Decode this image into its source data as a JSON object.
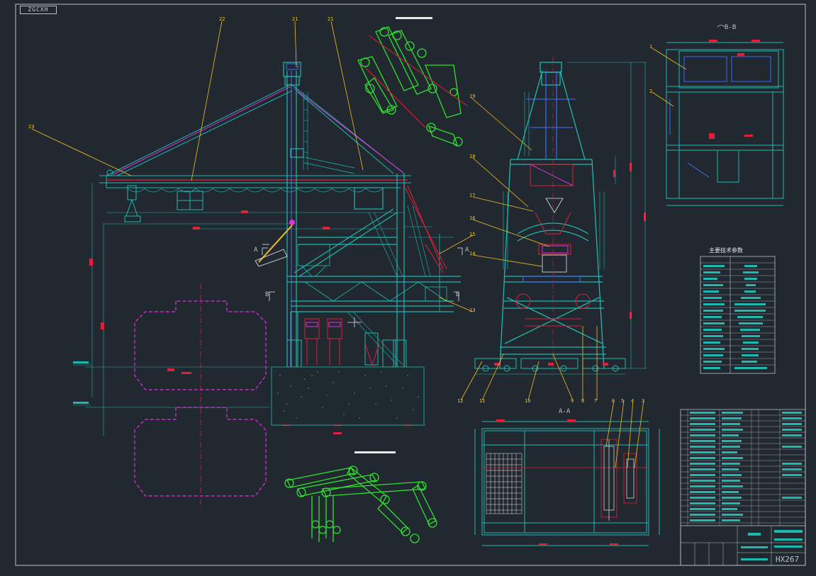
{
  "sheet_tag": "ZGCXH",
  "callouts": {
    "c1": "1",
    "c2": "2",
    "c3": "3",
    "c4": "4",
    "c5": "5",
    "c6": "6",
    "c7": "7",
    "c8": "8",
    "c9": "9",
    "c10": "10",
    "c11": "11",
    "c12": "12",
    "c13": "13",
    "c14": "14",
    "c15": "15",
    "c16": "16",
    "c17": "17",
    "c18": "18",
    "c19": "19",
    "c21a": "21",
    "c21b": "21",
    "c22": "22",
    "c23": "23"
  },
  "section_labels": {
    "bb": "B-B",
    "aa": "A-A",
    "a_left": "A",
    "a_right": "A",
    "b_left": "B",
    "b_right": "B"
  },
  "params_title": "主要技术参数",
  "drawing_no": "HX267",
  "colors": {
    "frame": "#b8c0c8",
    "structure": "#1fb8b0",
    "red": "#e0203a",
    "magenta": "#e030e0",
    "yellow": "#f0c020",
    "green": "#30e030",
    "blue": "#4070ff",
    "white": "#e8e8e8"
  }
}
